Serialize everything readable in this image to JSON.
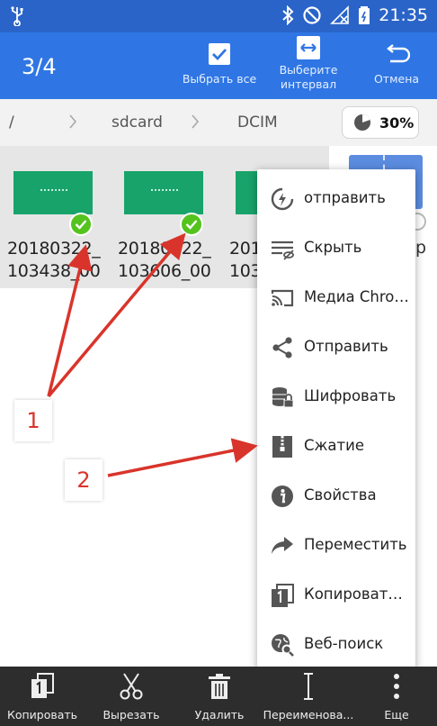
{
  "status_bar": {
    "time": "21:35"
  },
  "action_bar": {
    "selection_count": "3/4",
    "select_all_label": "Выбрать все",
    "select_interval_label": "Выберите\nинтервал",
    "cancel_label": "Отмена"
  },
  "breadcrumb": {
    "root": "/",
    "items": [
      "sdcard",
      "DCIM"
    ],
    "storage_percent": "30%"
  },
  "files": [
    {
      "name": "20180322_\n103438_00",
      "selected": true
    },
    {
      "name": "20180322_\n103606_00",
      "selected": true
    },
    {
      "name": "201\n103",
      "selected": false
    }
  ],
  "partial_text": "p",
  "context_menu": {
    "items": [
      {
        "label": "отправить",
        "icon": "share-alt-icon"
      },
      {
        "label": "Скрыть",
        "icon": "hide-icon"
      },
      {
        "label": "Медиа Chromecast",
        "icon": "cast-icon"
      },
      {
        "label": "Отправить",
        "icon": "share-icon"
      },
      {
        "label": "Шифровать",
        "icon": "encrypt-icon"
      },
      {
        "label": "Сжатие",
        "icon": "compress-icon"
      },
      {
        "label": "Свойства",
        "icon": "info-icon"
      },
      {
        "label": "Переместить",
        "icon": "move-icon"
      },
      {
        "label": "Копировать в",
        "icon": "copy-to-icon"
      },
      {
        "label": "Веб-поиск",
        "icon": "web-search-icon"
      }
    ]
  },
  "bottom_bar": {
    "copy": "Копировать",
    "cut": "Вырезать",
    "delete": "Удалить",
    "rename": "Переименова...",
    "more": "Еще"
  },
  "annotations": {
    "label_1": "1",
    "label_2": "2"
  },
  "colors": {
    "status_bar": "#2a64c8",
    "action_bar": "#2f76e4",
    "thumb_green": "#18a36b",
    "check_green": "#55c31e",
    "annotation_red": "#d9342b"
  }
}
